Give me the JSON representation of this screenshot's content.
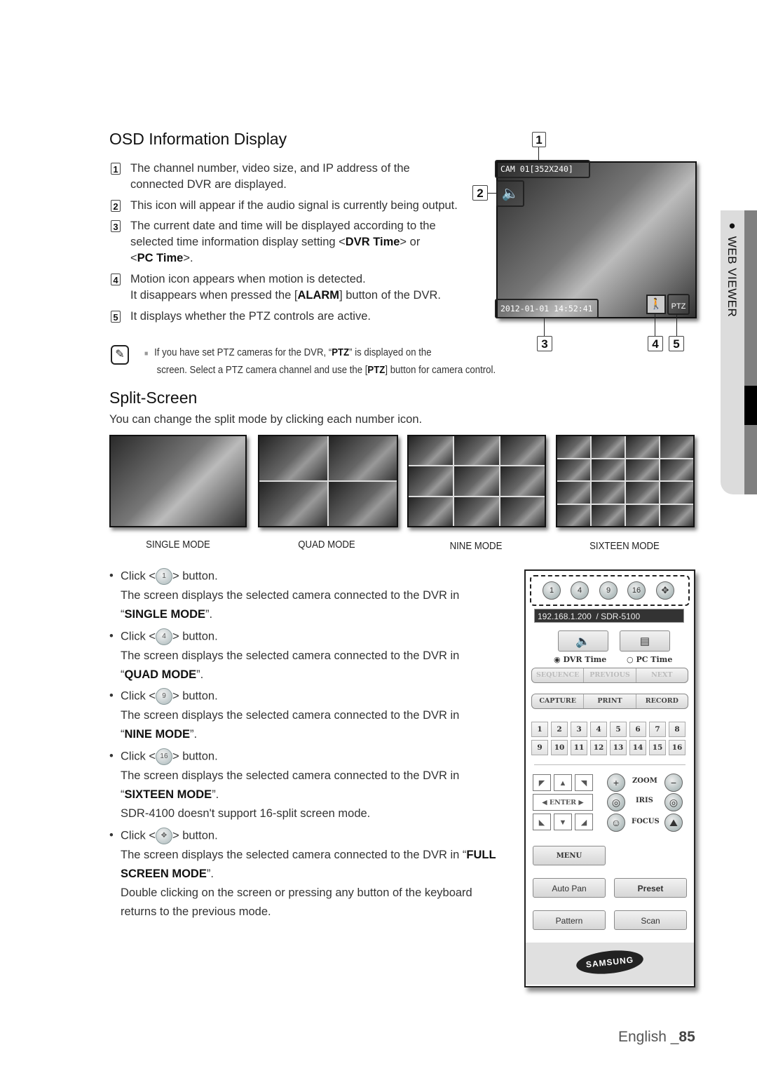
{
  "osd": {
    "title": "OSD Information Display",
    "items": [
      {
        "num": "1",
        "lines": [
          "The channel number, video size, and IP address of the",
          "connected DVR are displayed."
        ]
      },
      {
        "num": "2",
        "lines": [
          "This icon will appear if the audio signal is currently being output."
        ]
      },
      {
        "num": "3",
        "pre": "The current date and time will be displayed according to the",
        "pre2": "selected time information display setting <",
        "b1": "DVR Time",
        "mid": "> or",
        "pre3": "<",
        "b2": "PC Time",
        "post": ">."
      },
      {
        "num": "4",
        "line1": "Motion icon appears when motion is detected.",
        "pre": "It disappears when pressed the [",
        "b": "ALARM",
        "post": "] button of the DVR."
      },
      {
        "num": "5",
        "lines": [
          "It displays whether the PTZ controls are active."
        ]
      }
    ],
    "figure": {
      "callouts": [
        "1",
        "2",
        "3",
        "4",
        "5"
      ],
      "cam_label": "CAM 01[352X240]",
      "timestamp": "2012-01-01  14:52:41",
      "ptz_label": "PTZ",
      "audio_icon": "speaker-icon",
      "motion_icon": "walking-person-icon"
    },
    "note": {
      "pre": "If you have set PTZ cameras for the DVR, “",
      "b1": "PTZ",
      "mid": "” is displayed on the",
      "line2_pre": "screen. Select a PTZ camera channel and use the [",
      "b2": "PTZ",
      "line2_post": "] button for camera control."
    }
  },
  "split": {
    "title": "Split-Screen",
    "intro": "You can change the split mode by clicking each number icon.",
    "modes": [
      "SINGLE MODE",
      "QUAD MODE",
      "NINE MODE",
      "SIXTEEN MODE"
    ],
    "bullets": [
      {
        "click": "Click <",
        "icon": "1",
        "after": "> button.",
        "desc": "The screen displays the selected camera connected to the DVR in",
        "mode": "SINGLE MODE"
      },
      {
        "click": "Click <",
        "icon": "4",
        "after": "> button.",
        "desc": "The screen displays the selected camera connected to the DVR in",
        "mode": "QUAD MODE"
      },
      {
        "click": "Click <",
        "icon": "9",
        "after": "> button.",
        "desc": "The screen displays the selected camera connected to the DVR in",
        "mode": "NINE MODE"
      },
      {
        "click": "Click <",
        "icon": "16",
        "after": "> button.",
        "desc": "The screen displays the selected camera connected to the DVR in",
        "mode": "SIXTEEN MODE",
        "extra": "SDR-4100 doesn't support 16-split screen mode."
      },
      {
        "click": "Click <",
        "icon": "fullscreen",
        "after": "> button.",
        "desc": "The screen displays the selected camera connected to the DVR in “",
        "mode_a": "FULL",
        "mode_b": "SCREEN MODE",
        "extra1": "Double clicking on the screen or pressing any button of the keyboard",
        "extra2": "returns to the previous mode."
      }
    ]
  },
  "panel": {
    "mode_buttons": [
      "1",
      "4",
      "9",
      "16"
    ],
    "address": "192.168.1.200",
    "separator": "/",
    "model": "SDR-5100",
    "radio_dvr": "DVR Time",
    "radio_pc": "PC Time",
    "seq_row": [
      "SEQUENCE",
      "PREVIOUS",
      "NEXT"
    ],
    "cap_row": [
      "CAPTURE",
      "PRINT",
      "RECORD"
    ],
    "channels": [
      "1",
      "2",
      "3",
      "4",
      "5",
      "6",
      "7",
      "8",
      "9",
      "10",
      "11",
      "12",
      "13",
      "14",
      "15",
      "16"
    ],
    "enter": "ENTER",
    "zoom": "ZOOM",
    "iris": "IRIS",
    "focus": "FOCUS",
    "menu": "MENU",
    "auto_pan": "Auto Pan",
    "preset": "Preset",
    "pattern": "Pattern",
    "scan": "Scan",
    "logo": "SAMSUNG"
  },
  "sidebar": {
    "section": "WEB VIEWER"
  },
  "footer": {
    "lang": "English _",
    "page": "85"
  }
}
